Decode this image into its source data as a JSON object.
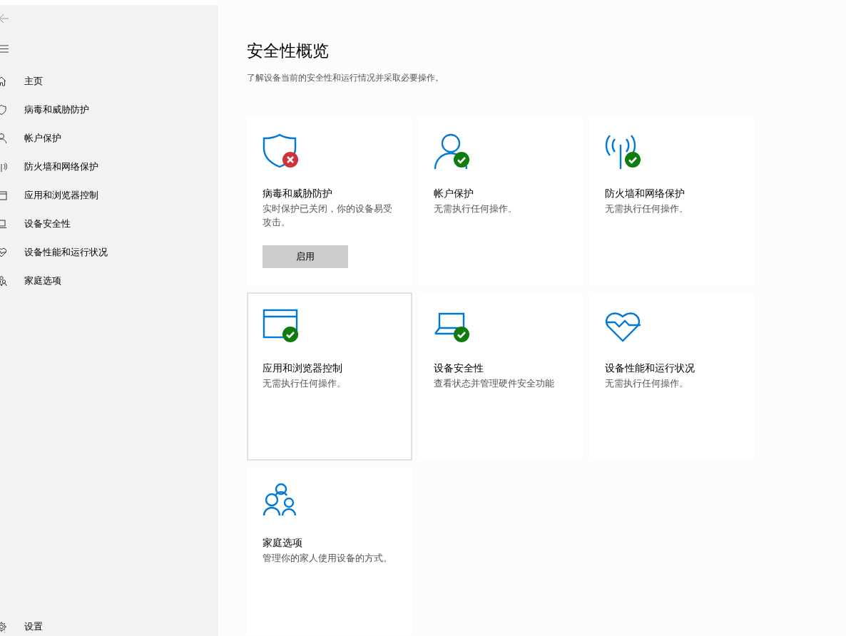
{
  "sidebar": {
    "items": [
      {
        "kind": "home",
        "label": "主页"
      },
      {
        "kind": "shield",
        "label": "病毒和威胁防护"
      },
      {
        "kind": "person",
        "label": "帐户保护"
      },
      {
        "kind": "antenna",
        "label": "防火墙和网络保护"
      },
      {
        "kind": "window",
        "label": "应用和浏览器控制"
      },
      {
        "kind": "laptop",
        "label": "设备安全性"
      },
      {
        "kind": "heart",
        "label": "设备性能和运行状况"
      },
      {
        "kind": "family",
        "label": "家庭选项"
      }
    ],
    "settings": {
      "label": "设置"
    }
  },
  "page": {
    "title": "安全性概览",
    "subtitle": "了解设备当前的安全性和运行情况并采取必要操作。"
  },
  "cards": [
    {
      "kind": "shield",
      "alert": true,
      "ok": false,
      "title": "病毒和威胁防护",
      "description": "实时保护已关闭，你的设备易受攻击。",
      "button": "启用",
      "focused": false
    },
    {
      "kind": "person",
      "alert": false,
      "ok": true,
      "title": "帐户保护",
      "description": "无需执行任何操作。",
      "focused": false
    },
    {
      "kind": "antenna",
      "alert": false,
      "ok": true,
      "title": "防火墙和网络保护",
      "description": "无需执行任何操作。",
      "focused": false
    },
    {
      "kind": "window",
      "alert": false,
      "ok": true,
      "title": "应用和浏览器控制",
      "description": "无需执行任何操作。",
      "focused": true
    },
    {
      "kind": "laptop",
      "alert": false,
      "ok": true,
      "title": "设备安全性",
      "description": "查看状态并管理硬件安全功能",
      "focused": false
    },
    {
      "kind": "heart",
      "alert": false,
      "ok": false,
      "title": "设备性能和运行状况",
      "description": "无需执行任何操作。",
      "focused": false
    },
    {
      "kind": "family",
      "alert": false,
      "ok": false,
      "title": "家庭选项",
      "description": "管理你的家人使用设备的方式。",
      "focused": false
    }
  ]
}
